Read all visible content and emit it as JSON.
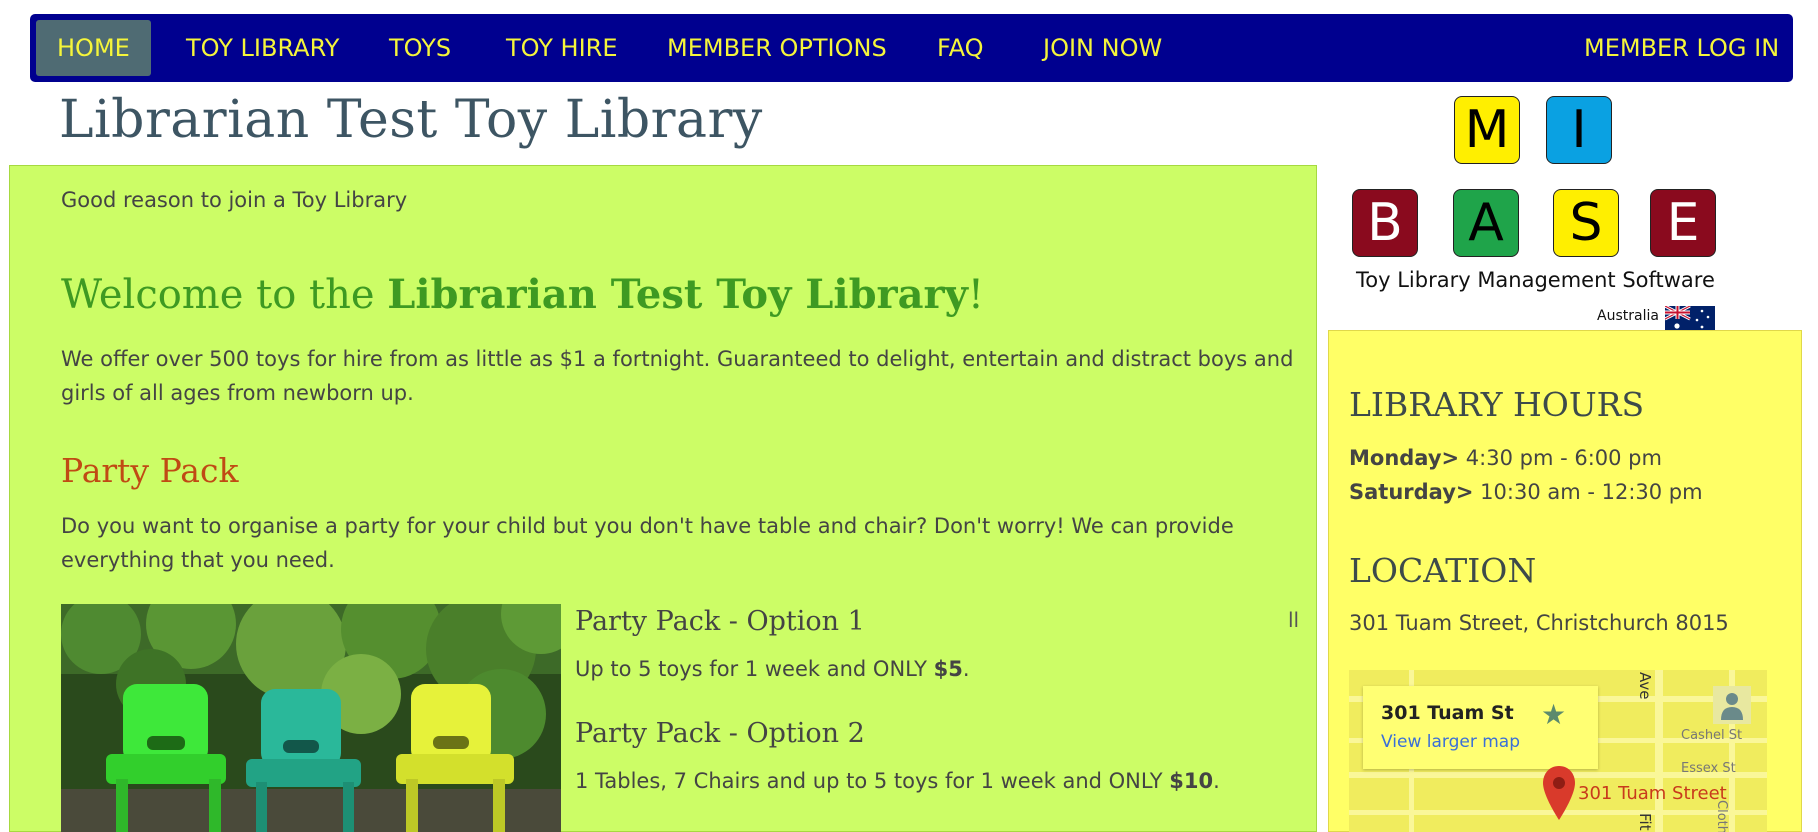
{
  "nav": {
    "items": [
      {
        "label": "HOME"
      },
      {
        "label": "TOY LIBRARY"
      },
      {
        "label": "TOYS"
      },
      {
        "label": "TOY HIRE"
      },
      {
        "label": "MEMBER OPTIONS"
      },
      {
        "label": "FAQ"
      },
      {
        "label": "JOIN NOW"
      }
    ],
    "login": "MEMBER LOG IN",
    "active": "HOME"
  },
  "page_title": "Librarian Test Toy Library",
  "main": {
    "reason": "Good reason to join a Toy Library",
    "welcome_prefix": "Welcome to the ",
    "welcome_name": "Librarian Test Toy Library",
    "welcome_suffix": "!",
    "intro": "We offer over 500 toys for hire from as little as $1 a fortnight. Guaranteed to delight, entertain and distract boys and girls of all ages from newborn up.",
    "party_title": "Party Pack",
    "party_text": "Do you want to organise a party for your child but you don't have table and chair? Don't worry! We can provide everything that you need.",
    "options": [
      {
        "title": "Party Pack - Option 1",
        "text": "Up to 5 toys for 1 week and ONLY ",
        "price": "$5",
        "end": "."
      },
      {
        "title": "Party Pack - Option 2",
        "text": "1 Tables, 7 Chairs and up to 5 toys for 1 week and ONLY ",
        "price": "$10",
        "end": "."
      }
    ],
    "slideshow_pause": "ll"
  },
  "logo": {
    "letters_top": [
      "M",
      "I"
    ],
    "letters_bottom": [
      "B",
      "A",
      "S",
      "E"
    ],
    "caption": "Toy Library Management Software",
    "country": "Australia"
  },
  "sidebar": {
    "hours_title": "LIBRARY HOURS",
    "hours": [
      {
        "day": "Monday>",
        "time": " 4:30 pm - 6:00 pm"
      },
      {
        "day": "Saturday>",
        "time": " 10:30 am - 12:30 pm"
      }
    ],
    "location_title": "LOCATION",
    "address": "301 Tuam Street, Christchurch 8015"
  },
  "map": {
    "card_title": "301 Tuam St",
    "card_link": "View larger map",
    "pin_label": "301 Tuam Street",
    "street_labels": [
      "Cashel St",
      "Essex St",
      "Clothier St",
      "Ave",
      "Fit"
    ]
  },
  "colors": {
    "nav_bg": "#00008f",
    "nav_text": "#f5f53a",
    "main_panel": "#ccfd66",
    "sidebar_panel": "#ffff66",
    "welcome_green": "#3e9a22",
    "party_orange": "#c04a14"
  }
}
